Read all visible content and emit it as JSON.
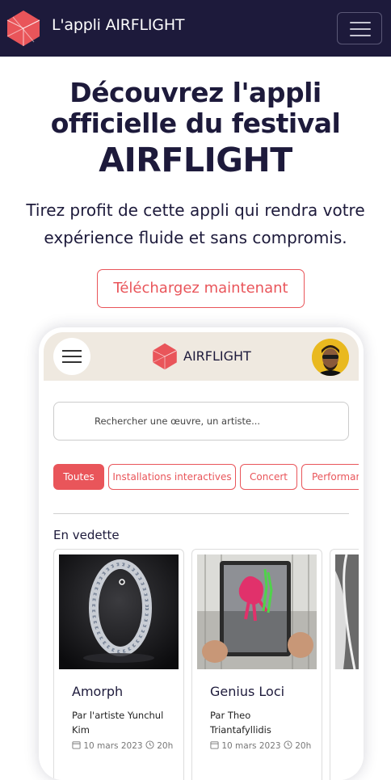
{
  "header": {
    "title": "L'appli AIRFLIGHT",
    "menu_icon": "hamburger-icon"
  },
  "hero": {
    "title_line1": "Découvrez l'appli",
    "title_line2": "officielle du festival",
    "title_big": "AIRFLIGHT",
    "subtitle": "Tirez profit de cette appli qui rendra votre expérience fluide et sans compromis.",
    "cta_label": "Téléchargez maintenant"
  },
  "app": {
    "title": "AIRFLIGHT",
    "search_placeholder": "Rechercher une œuvre, un artiste...",
    "chips": [
      "Toutes",
      "Installations interactives",
      "Concert",
      "Performances"
    ],
    "section_title": "En vedette",
    "cards": [
      {
        "title": "Amorph",
        "artist": "Par l'artiste Yunchul Kim",
        "date": "10 mars 2023",
        "time": "20h"
      },
      {
        "title": "Genius Loci",
        "artist": "Par Theo Triantafyllidis",
        "date": "10 mars 2023",
        "time": "20h"
      },
      {
        "title": "",
        "artist": "",
        "date": "",
        "time": ""
      }
    ]
  },
  "colors": {
    "navy": "#1d1a3b",
    "accent": "#e9555a",
    "app_bar": "#efe9e0"
  }
}
